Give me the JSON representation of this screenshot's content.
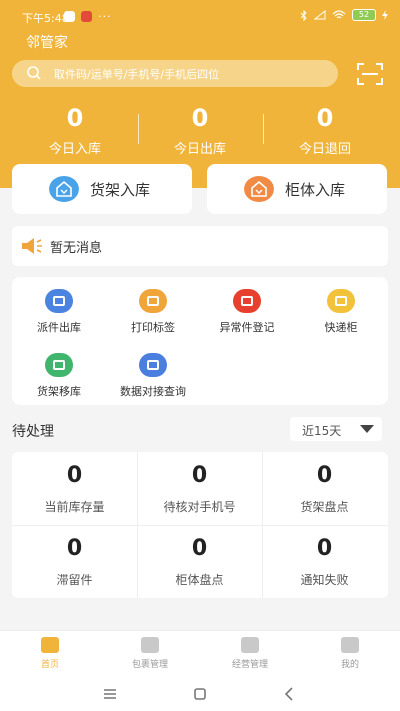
{
  "status_bar": {
    "time": "下午5:48",
    "dots": "···",
    "battery": "52"
  },
  "app_title": "邻管家",
  "search": {
    "placeholder": "取件码/运单号/手机号/手机后四位"
  },
  "stats": [
    {
      "value": "0",
      "label": "今日入库"
    },
    {
      "value": "0",
      "label": "今日出库"
    },
    {
      "value": "0",
      "label": "今日退回"
    }
  ],
  "actions": [
    {
      "label": "货架入库",
      "color": "#4aa3e8"
    },
    {
      "label": "柜体入库",
      "color": "#f08a45"
    }
  ],
  "message": "暂无消息",
  "tools": [
    {
      "label": "派件出库",
      "color": "#4a84e0"
    },
    {
      "label": "打印标签",
      "color": "#f0a53a"
    },
    {
      "label": "异常件登记",
      "color": "#e8402f"
    },
    {
      "label": "快递柜",
      "color": "#f2c23a"
    },
    {
      "label": "货架移库",
      "color": "#3fb56e"
    },
    {
      "label": "数据对接查询",
      "color": "#4a7fe0"
    }
  ],
  "pending": {
    "title": "待处理",
    "range": "近15天",
    "items": [
      {
        "value": "0",
        "label": "当前库存量"
      },
      {
        "value": "0",
        "label": "待核对手机号"
      },
      {
        "value": "0",
        "label": "货架盘点"
      },
      {
        "value": "0",
        "label": "滞留件"
      },
      {
        "value": "0",
        "label": "柜体盘点"
      },
      {
        "value": "0",
        "label": "通知失败"
      }
    ]
  },
  "tabs": [
    {
      "label": "首页",
      "active": true
    },
    {
      "label": "包裹管理",
      "active": false
    },
    {
      "label": "经营管理",
      "active": false
    },
    {
      "label": "我的",
      "active": false
    }
  ],
  "colors": {
    "brand": "#f0b43a"
  }
}
